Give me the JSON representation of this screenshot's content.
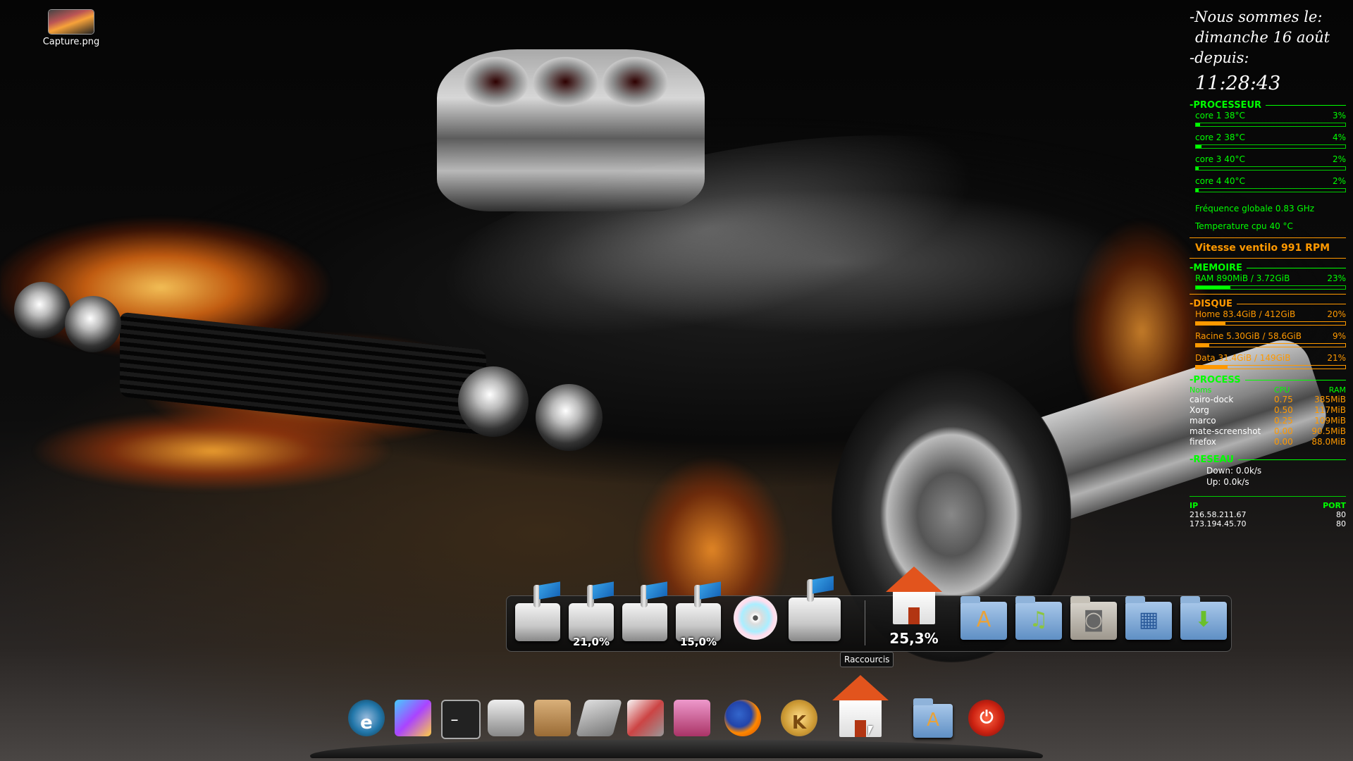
{
  "desktop": {
    "icons": [
      {
        "label": "Capture.png"
      }
    ]
  },
  "conky": {
    "date_line1": "-Nous sommes le:",
    "date_line2": "dimanche 16 août",
    "date_line3": "-depuis:",
    "clock": "11:28:43",
    "processor": {
      "title": "PROCESSEUR",
      "cores": [
        {
          "label": "core 1  38°C",
          "pct": "3%",
          "value": 3
        },
        {
          "label": "core 2  38°C",
          "pct": "4%",
          "value": 4
        },
        {
          "label": "core 3  40°C",
          "pct": "2%",
          "value": 2
        },
        {
          "label": "core 4  40°C",
          "pct": "2%",
          "value": 2
        }
      ],
      "freq": "Fréquence globale 0.83 GHz",
      "temp": "Temperature cpu 40 °C",
      "fan": "Vitesse ventilo 991 RPM"
    },
    "memory": {
      "title": "MEMOIRE",
      "ram_label": "RAM  890MiB / 3.72GiB",
      "ram_pct": "23%",
      "value": 23
    },
    "disk": {
      "title": "DISQUE",
      "items": [
        {
          "label": "Home  83.4GiB / 412GiB",
          "pct": "20%",
          "value": 20
        },
        {
          "label": "Racine  5.30GiB / 58.6GiB",
          "pct": "9%",
          "value": 9
        },
        {
          "label": "Data  31.4GiB / 149GiB",
          "pct": "21%",
          "value": 21
        }
      ]
    },
    "process": {
      "title": "PROCESS",
      "headers": [
        "Noms",
        "CPU",
        "RAM"
      ],
      "rows": [
        [
          "cairo-dock",
          "0.75",
          "385MiB"
        ],
        [
          "Xorg",
          "0.50",
          "117MiB"
        ],
        [
          "marco",
          "0.25",
          "109MiB"
        ],
        [
          "mate-screenshot",
          "0.00",
          "90.5MiB"
        ],
        [
          "firefox",
          "0.00",
          "88.0MiB"
        ]
      ]
    },
    "network": {
      "title": "RESEAU",
      "down": "Down: 0.0k/s",
      "up": "Up: 0.0k/s",
      "ip_header": "IP",
      "port_header": "PORT",
      "connections": [
        [
          "216.58.211.67",
          "80"
        ],
        [
          "173.194.45.70",
          "80"
        ]
      ]
    }
  },
  "dock_top": {
    "drive_pcts": [
      "",
      "21,0%",
      "",
      "15,0%"
    ],
    "home_pct": "25,3%",
    "tooltip": "Raccourcis"
  },
  "colors": {
    "accent_green": "#00ff00",
    "accent_orange": "#ff9900"
  }
}
